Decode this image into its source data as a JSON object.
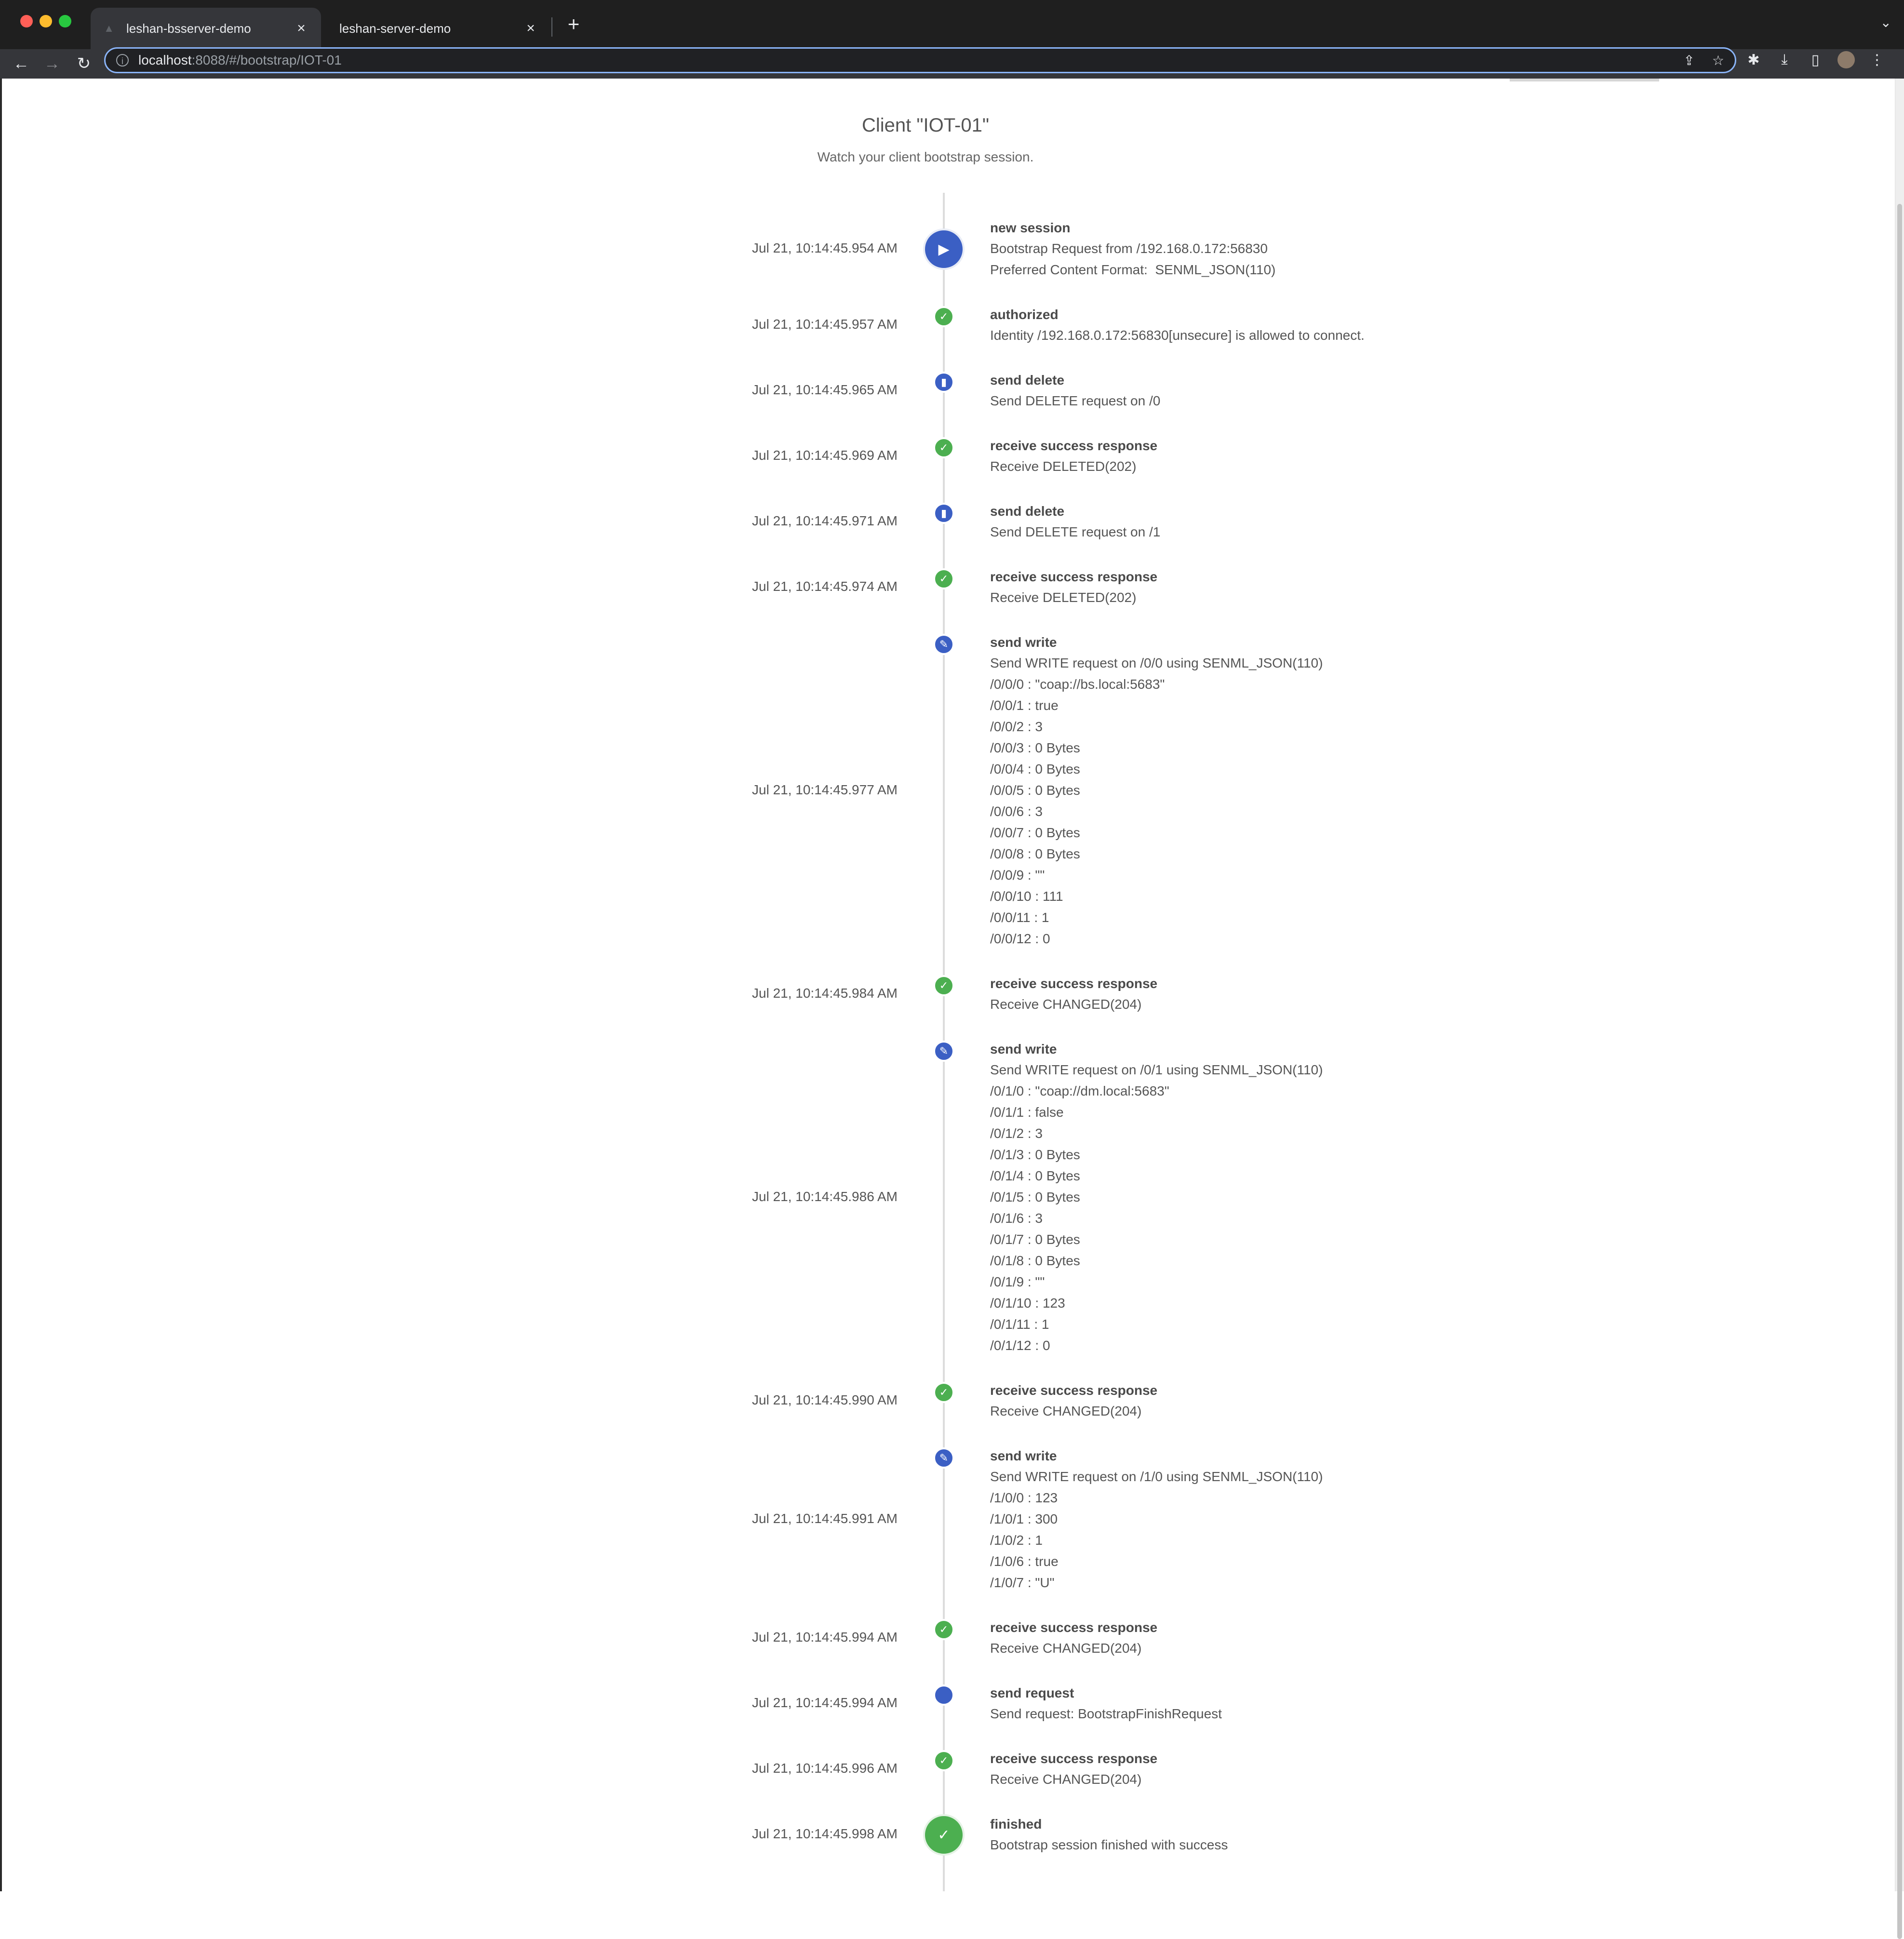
{
  "browser": {
    "tabs": [
      {
        "title": "leshan-bsserver-demo",
        "active": true
      },
      {
        "title": "leshan-server-demo",
        "active": false
      }
    ],
    "url_host": "localhost",
    "url_path": ":8088/#/bootstrap/IOT-01"
  },
  "page": {
    "title": "Client \"IOT-01\"",
    "subtitle": "Watch your client bootstrap session."
  },
  "colors": {
    "accent_blue": "#3b5fc4",
    "success_green": "#4caf50"
  },
  "events": [
    {
      "time": "Jul 21, 10:14:45.954 AM",
      "title": "new session",
      "icon": "play-icon",
      "color": "blue",
      "big": true,
      "lines": [
        "Bootstrap Request from /192.168.0.172:56830",
        "Preferred Content Format:  SENML_JSON(110)"
      ]
    },
    {
      "time": "Jul 21, 10:14:45.957 AM",
      "title": "authorized",
      "icon": "user-check-icon",
      "color": "green",
      "lines": [
        "Identity /192.168.0.172:56830[unsecure] is allowed to connect."
      ]
    },
    {
      "time": "Jul 21, 10:14:45.965 AM",
      "title": "send delete",
      "icon": "trash-icon",
      "color": "blue",
      "lines": [
        "Send DELETE request on /0"
      ]
    },
    {
      "time": "Jul 21, 10:14:45.969 AM",
      "title": "receive success response",
      "icon": "check-icon",
      "color": "green",
      "lines": [
        "Receive DELETED(202)"
      ]
    },
    {
      "time": "Jul 21, 10:14:45.971 AM",
      "title": "send delete",
      "icon": "trash-icon",
      "color": "blue",
      "lines": [
        "Send DELETE request on /1"
      ]
    },
    {
      "time": "Jul 21, 10:14:45.974 AM",
      "title": "receive success response",
      "icon": "check-icon",
      "color": "green",
      "lines": [
        "Receive DELETED(202)"
      ]
    },
    {
      "time": "Jul 21, 10:14:45.977 AM",
      "title": "send write",
      "icon": "pencil-icon",
      "color": "blue",
      "lines": [
        "Send WRITE request on /0/0 using SENML_JSON(110)",
        "/0/0/0 : \"coap://bs.local:5683\"",
        "/0/0/1 : true",
        "/0/0/2 : 3",
        "/0/0/3 : 0 Bytes",
        "/0/0/4 : 0 Bytes",
        "/0/0/5 : 0 Bytes",
        "/0/0/6 : 3",
        "/0/0/7 : 0 Bytes",
        "/0/0/8 : 0 Bytes",
        "/0/0/9 : \"\"",
        "/0/0/10 : 111",
        "/0/0/11 : 1",
        "/0/0/12 : 0"
      ]
    },
    {
      "time": "Jul 21, 10:14:45.984 AM",
      "title": "receive success response",
      "icon": "check-icon",
      "color": "green",
      "lines": [
        "Receive CHANGED(204)"
      ]
    },
    {
      "time": "Jul 21, 10:14:45.986 AM",
      "title": "send write",
      "icon": "pencil-icon",
      "color": "blue",
      "lines": [
        "Send WRITE request on /0/1 using SENML_JSON(110)",
        "/0/1/0 : \"coap://dm.local:5683\"",
        "/0/1/1 : false",
        "/0/1/2 : 3",
        "/0/1/3 : 0 Bytes",
        "/0/1/4 : 0 Bytes",
        "/0/1/5 : 0 Bytes",
        "/0/1/6 : 3",
        "/0/1/7 : 0 Bytes",
        "/0/1/8 : 0 Bytes",
        "/0/1/9 : \"\"",
        "/0/1/10 : 123",
        "/0/1/11 : 1",
        "/0/1/12 : 0"
      ]
    },
    {
      "time": "Jul 21, 10:14:45.990 AM",
      "title": "receive success response",
      "icon": "check-icon",
      "color": "green",
      "lines": [
        "Receive CHANGED(204)"
      ]
    },
    {
      "time": "Jul 21, 10:14:45.991 AM",
      "title": "send write",
      "icon": "pencil-icon",
      "color": "blue",
      "lines": [
        "Send WRITE request on /1/0 using SENML_JSON(110)",
        "/1/0/0 : 123",
        "/1/0/1 : 300",
        "/1/0/2 : 1",
        "/1/0/6 : true",
        "/1/0/7 : \"U\""
      ]
    },
    {
      "time": "Jul 21, 10:14:45.994 AM",
      "title": "receive success response",
      "icon": "check-icon",
      "color": "green",
      "lines": [
        "Receive CHANGED(204)"
      ]
    },
    {
      "time": "Jul 21, 10:14:45.994 AM",
      "title": "send request",
      "icon": "circle-icon",
      "color": "blue",
      "lines": [
        "Send request: BootstrapFinishRequest"
      ]
    },
    {
      "time": "Jul 21, 10:14:45.996 AM",
      "title": "receive success response",
      "icon": "check-icon",
      "color": "green",
      "lines": [
        "Receive CHANGED(204)"
      ]
    },
    {
      "time": "Jul 21, 10:14:45.998 AM",
      "title": "finished",
      "icon": "check-icon",
      "color": "green",
      "big": true,
      "lines": [
        "Bootstrap session finished with success"
      ]
    }
  ]
}
